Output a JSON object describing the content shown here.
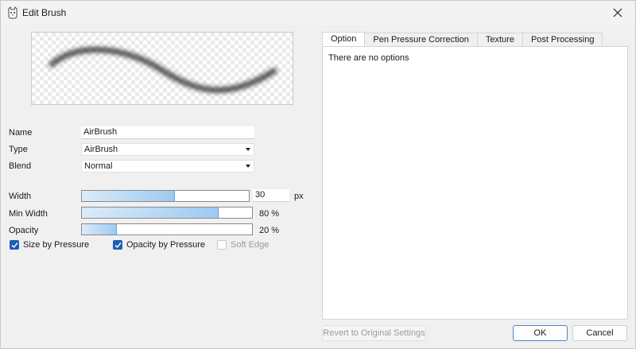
{
  "window": {
    "title": "Edit Brush"
  },
  "form": {
    "name_label": "Name",
    "name_value": "AirBrush",
    "type_label": "Type",
    "type_value": "AirBrush",
    "blend_label": "Blend",
    "blend_value": "Normal"
  },
  "sliders": {
    "width": {
      "label": "Width",
      "value": "30",
      "unit": "px",
      "fill_fraction": 0.55
    },
    "min_width": {
      "label": "Min Width",
      "value_text": "80 %",
      "fill_fraction": 0.8
    },
    "opacity": {
      "label": "Opacity",
      "value_text": "20 %",
      "fill_fraction": 0.2
    }
  },
  "checkboxes": {
    "size_by_pressure": {
      "label": "Size by Pressure",
      "checked": true
    },
    "opacity_by_pressure": {
      "label": "Opacity by Pressure",
      "checked": true
    },
    "soft_edge": {
      "label": "Soft Edge",
      "checked": false,
      "disabled": true
    }
  },
  "tabs": [
    {
      "label": "Option",
      "active": true
    },
    {
      "label": "Pen Pressure Correction",
      "active": false
    },
    {
      "label": "Texture",
      "active": false
    },
    {
      "label": "Post Processing",
      "active": false
    }
  ],
  "panel": {
    "message": "There are no options"
  },
  "buttons": {
    "revert": "Revert to Original Settings",
    "ok": "OK",
    "cancel": "Cancel"
  },
  "icons": {
    "app": "cat-app-icon",
    "close": "close-icon",
    "dropdown": "chevron-down-icon",
    "check": "checkmark-icon"
  },
  "colors": {
    "accent": "#1b5fb3",
    "slider_fill": "#9ccaf0",
    "ok_border": "#4f86c6"
  }
}
